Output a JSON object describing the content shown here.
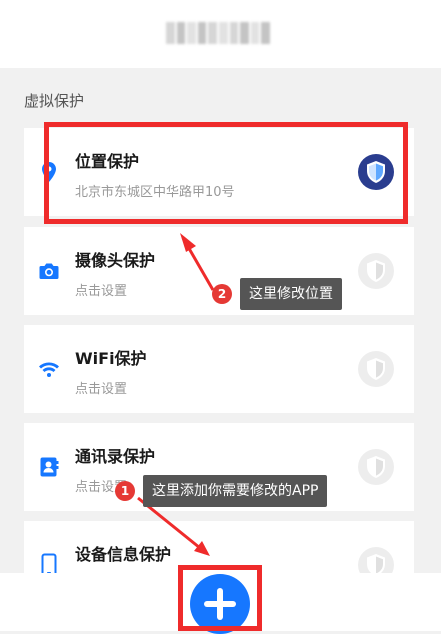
{
  "section": {
    "title": "虚拟保护"
  },
  "items": [
    {
      "name": "位置保护",
      "subtitle": "北京市东城区中华路甲10号",
      "icon": "location-pin-icon",
      "enabled": true
    },
    {
      "name": "摄像头保护",
      "subtitle": "点击设置",
      "icon": "camera-icon",
      "enabled": false
    },
    {
      "name": "WiFi保护",
      "subtitle": "点击设置",
      "icon": "wifi-icon",
      "enabled": false
    },
    {
      "name": "通讯录保护",
      "subtitle": "点击设置",
      "icon": "contacts-icon",
      "enabled": false
    },
    {
      "name": "设备信息保护",
      "subtitle": "",
      "icon": "phone-device-icon",
      "enabled": false
    }
  ],
  "annotations": [
    {
      "number": "1",
      "text": "这里添加你需要修改的APP"
    },
    {
      "number": "2",
      "text": "这里修改位置"
    }
  ],
  "fab": {
    "icon": "plus-icon"
  },
  "colors": {
    "accent": "#1677ff",
    "highlight": "#ef2b2b",
    "shield_on": "#2a3d8f"
  }
}
